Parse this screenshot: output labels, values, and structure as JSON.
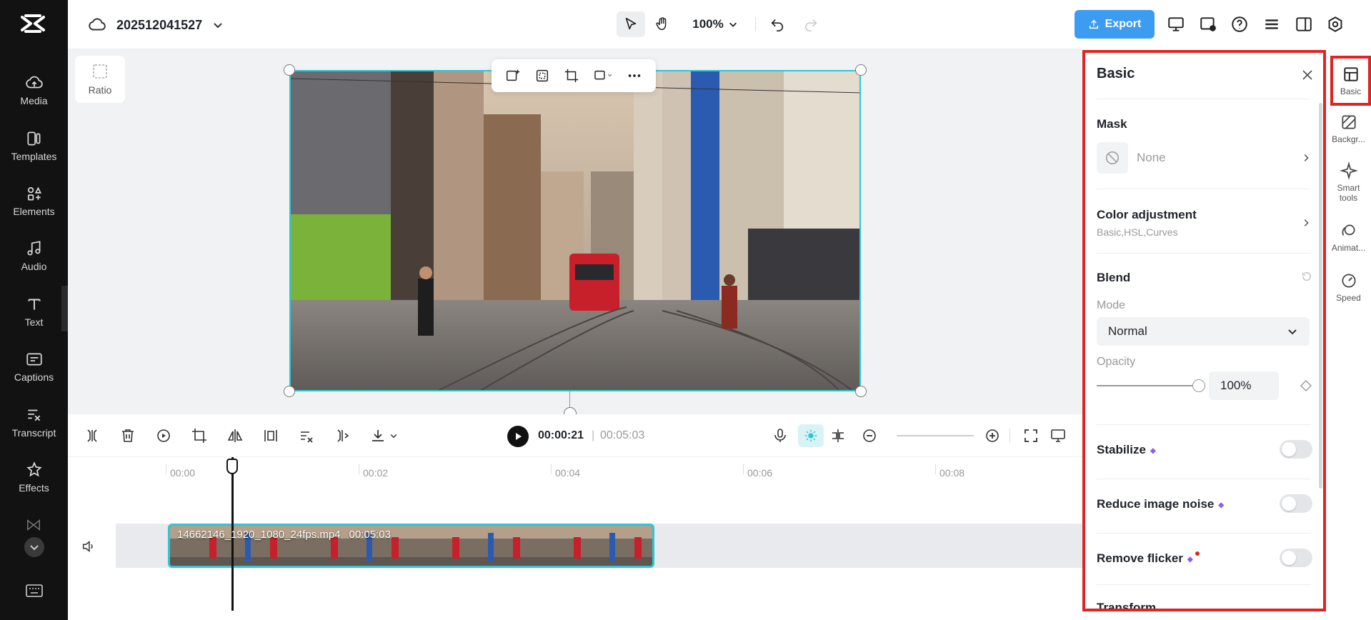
{
  "sidebar": {
    "items": [
      {
        "label": "Media",
        "icon": "cloud-upload-icon"
      },
      {
        "label": "Templates",
        "icon": "templates-icon"
      },
      {
        "label": "Elements",
        "icon": "elements-icon"
      },
      {
        "label": "Audio",
        "icon": "music-note-icon"
      },
      {
        "label": "Text",
        "icon": "text-icon"
      },
      {
        "label": "Captions",
        "icon": "captions-icon"
      },
      {
        "label": "Transcript",
        "icon": "transcript-icon"
      },
      {
        "label": "Effects",
        "icon": "effects-icon"
      }
    ]
  },
  "topbar": {
    "project_name": "202512041527",
    "zoom": "100%",
    "export_label": "Export"
  },
  "canvas": {
    "ratio_label": "Ratio"
  },
  "playback": {
    "current_time": "00:00:21",
    "separator": "|",
    "total_time": "00:05:03"
  },
  "timeline": {
    "ticks": [
      "00:00",
      "00:02",
      "00:04",
      "00:06",
      "00:08"
    ],
    "clip": {
      "filename": "14662146_1920_1080_24fps.mp4",
      "duration": "00:05:03"
    }
  },
  "panel": {
    "title": "Basic",
    "mask": {
      "title": "Mask",
      "value": "None"
    },
    "color": {
      "title": "Color adjustment",
      "sub": "Basic,HSL,Curves"
    },
    "blend": {
      "title": "Blend",
      "mode_label": "Mode",
      "mode_value": "Normal",
      "opacity_label": "Opacity",
      "opacity_value": "100%",
      "opacity_level": 1.0
    },
    "stabilize": {
      "label": "Stabilize",
      "on": false
    },
    "reduce_noise": {
      "label": "Reduce image noise",
      "on": false
    },
    "remove_flicker": {
      "label": "Remove flicker",
      "on": false
    },
    "transform": {
      "title": "Transform"
    }
  },
  "right_tabs": [
    {
      "label": "Basic",
      "icon": "basic-icon"
    },
    {
      "label": "Backgr...",
      "icon": "background-icon"
    },
    {
      "label": "Smart tools",
      "icon": "sparkle-icon"
    },
    {
      "label": "Animat...",
      "icon": "animation-icon"
    },
    {
      "label": "Speed",
      "icon": "speed-icon"
    }
  ],
  "colors": {
    "accent": "#2dc6d6",
    "export": "#3b9cf2",
    "highlight": "#e02424"
  }
}
